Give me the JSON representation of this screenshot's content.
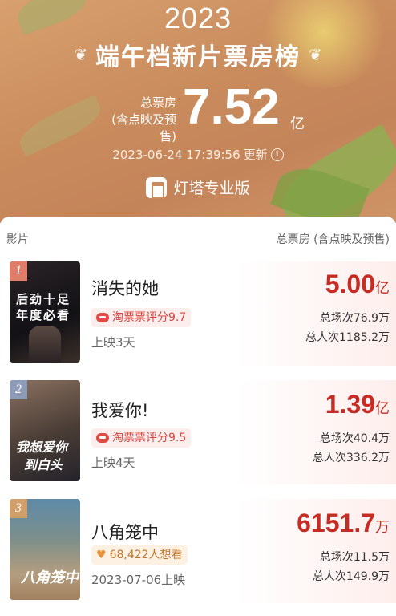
{
  "header": {
    "year": "2023",
    "title": "端午档新片票房榜",
    "total_label_line1": "总票房",
    "total_label_line2": "(含点映及预售)",
    "total_value": "7.52",
    "total_unit": "亿",
    "update_time": "2023-06-24 17:39:56",
    "update_suffix": "更新",
    "brand": "灯塔专业版"
  },
  "table": {
    "col_left": "影片",
    "col_right": "总票房 (含点映及预售)"
  },
  "movies": [
    {
      "rank": "1",
      "name": "消失的她",
      "tag": "淘票票评分9.7",
      "release": "上映3天",
      "box": "5.00",
      "unit": "亿",
      "sessions": "总场次76.9万",
      "viewers": "总人次1185.2万",
      "poster_text1": "后劲十足",
      "poster_text2": "年度必看",
      "poster_colors": [
        "#1c1a1e",
        "#3a2f2a"
      ]
    },
    {
      "rank": "2",
      "name": "我爱你!",
      "tag": "淘票票评分9.5",
      "release": "上映4天",
      "box": "1.39",
      "unit": "亿",
      "sessions": "总场次40.4万",
      "viewers": "总人次336.2万",
      "poster_text1": "我想爱你",
      "poster_text2": "到白头",
      "poster_colors": [
        "#6f5a4a",
        "#2a2a30"
      ]
    },
    {
      "rank": "3",
      "name": "八角笼中",
      "tag": "68,422人想看",
      "release": "2023-07-06上映",
      "box": "6151.7",
      "unit": "万",
      "sessions": "总场次11.5万",
      "viewers": "总人次149.9万",
      "poster_text1": "八角笼中",
      "poster_text2": "",
      "poster_colors": [
        "#4d6f8a",
        "#b7a183"
      ]
    }
  ],
  "colors": {
    "accent_red": "#c62c24",
    "tag_red": "#d9463f",
    "rank1": "#e07c6a",
    "rank2": "#8e9bb6",
    "rank3": "#d1a06a"
  }
}
